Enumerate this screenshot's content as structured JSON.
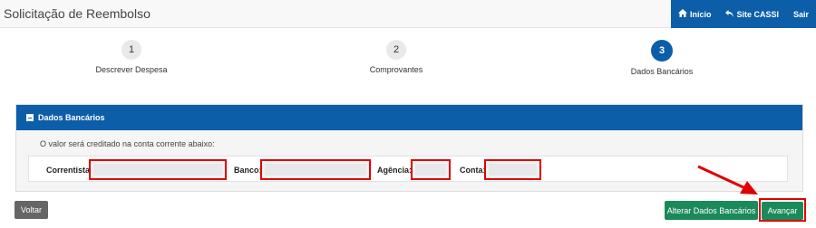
{
  "header": {
    "title": "Solicitação de Reembolso",
    "nav": [
      {
        "label": "Início",
        "icon": "home-icon"
      },
      {
        "label": "Site CASSI",
        "icon": "reply-icon"
      },
      {
        "label": "Sair"
      }
    ]
  },
  "steps": [
    {
      "number": "1",
      "label": "Descrever Despesa",
      "active": false
    },
    {
      "number": "2",
      "label": "Comprovantes",
      "active": false
    },
    {
      "number": "3",
      "label": "Dados Bancários",
      "active": true
    }
  ],
  "panel": {
    "title": "Dados Bancários",
    "note": "O valor será creditado na conta corrente abaixo:",
    "fields": [
      {
        "label": "Correntista:",
        "value": ""
      },
      {
        "label": "Banco:",
        "value": ""
      },
      {
        "label": "Agência:",
        "value": ""
      },
      {
        "label": "Conta:",
        "value": ""
      }
    ]
  },
  "buttons": {
    "back": "Voltar",
    "edit_bank": "Alterar Dados Bancários",
    "next": "Avançar"
  },
  "colors": {
    "primary": "#0c5ea8",
    "success": "#1b8a5a",
    "highlight": "#e00000"
  }
}
